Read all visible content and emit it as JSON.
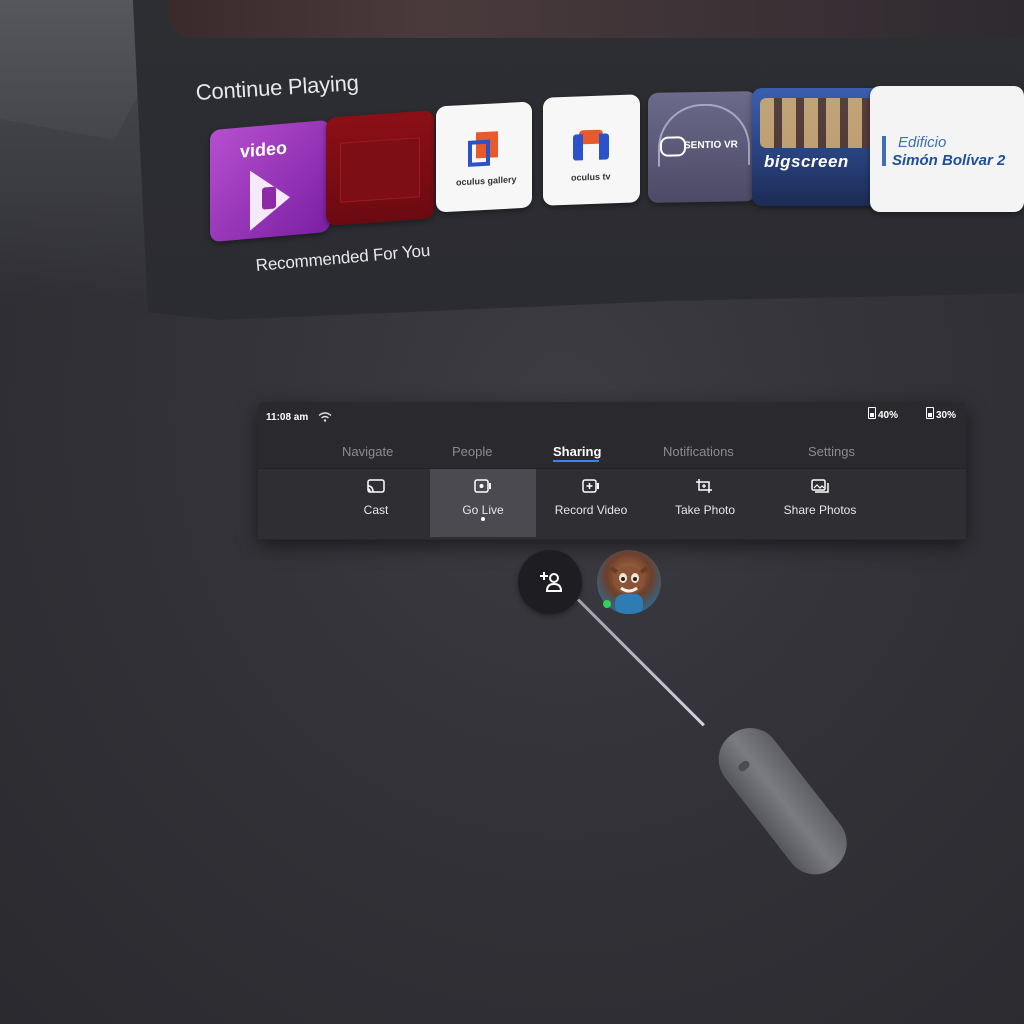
{
  "home": {
    "continue_title": "Continue Playing",
    "recommended_title": "Recommended For You",
    "tiles": [
      {
        "name": "video",
        "label": "video"
      },
      {
        "name": "red-app",
        "label": ""
      },
      {
        "name": "oculus-gallery",
        "label": "oculus gallery"
      },
      {
        "name": "oculus-tv",
        "label": "oculus tv"
      },
      {
        "name": "sentio-vr",
        "label": "SENTIO VR"
      },
      {
        "name": "bigscreen",
        "label": "bigscreen"
      },
      {
        "name": "edificio",
        "label_line1": "Edificio",
        "label_line2": "Simón Bolívar 2"
      }
    ]
  },
  "status": {
    "time": "11:08 am",
    "battery_a": "40%",
    "battery_b": "30%"
  },
  "tabs": {
    "navigate": "Navigate",
    "people": "People",
    "sharing": "Sharing",
    "notifications": "Notifications",
    "settings": "Settings",
    "active": "Sharing"
  },
  "actions": {
    "cast": "Cast",
    "go_live": "Go Live",
    "record_video": "Record Video",
    "take_photo": "Take Photo",
    "share_photos": "Share Photos",
    "selected": "Go Live"
  },
  "colors": {
    "accent": "#3b82f6",
    "online": "#33d15a"
  },
  "icons": [
    "wifi-icon",
    "battery-icon",
    "cast-icon",
    "go-live-icon",
    "record-video-icon",
    "take-photo-icon",
    "share-photos-icon",
    "add-friend-icon"
  ]
}
